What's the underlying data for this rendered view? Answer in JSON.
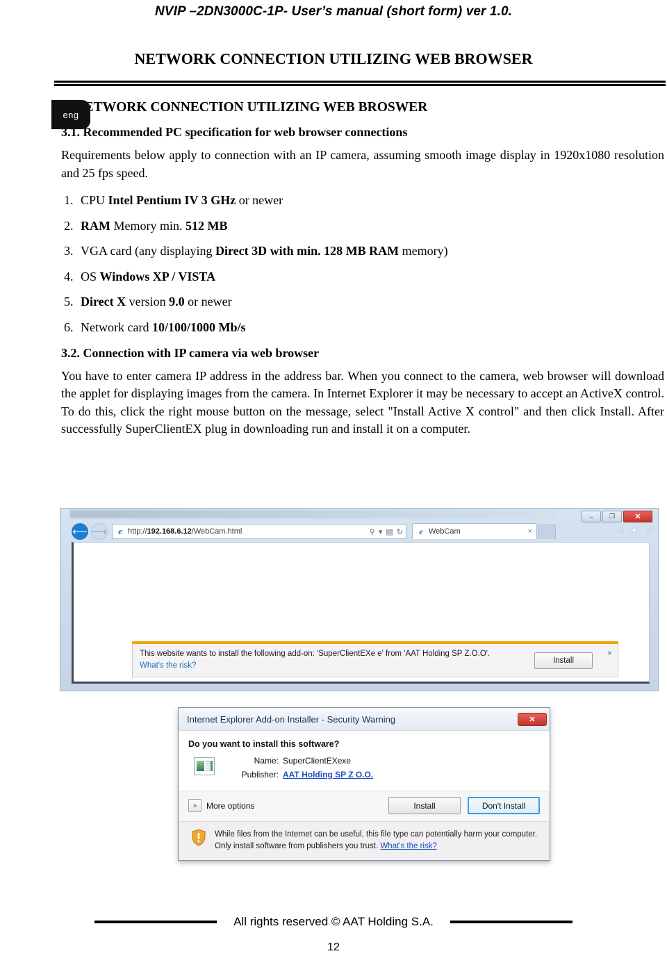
{
  "header": {
    "running_title": "NVIP –2DN3000C-1P- User’s manual (short form) ver 1.0."
  },
  "doc_title": "NETWORK CONNECTION UTILIZING WEB BROWSER",
  "language_tab": "eng",
  "sections": {
    "s3_heading": "3. NETWORK CONNECTION UTILIZING WEB BROSWER",
    "s31_heading": "3.1. Recommended PC specification for web browser connections",
    "s31_paragraph": "Requirements below apply to connection with an IP camera, assuming smooth image display in 1920x1080 resolution and 25 fps speed.",
    "s32_heading": "3.2. Connection with IP camera via web browser",
    "s32_paragraph": "You have to enter camera IP address in the address bar. When you connect to the camera, web browser will download the applet for displaying images from the camera. In Internet Explorer it may be necessary to accept an ActiveX control. To do this, click the right mouse button on the message, select \"Install Active X control\" and then click Install. After successfully SuperClientEX plug in downloading run and install it on a computer."
  },
  "specs": [
    {
      "prefix": "CPU ",
      "bold": "Intel Pentium IV 3 GHz",
      "suffix": " or newer"
    },
    {
      "prefix": "",
      "bold": "RAM",
      "mid": " Memory min. ",
      "bold2": "512 MB",
      "suffix": ""
    },
    {
      "prefix": "VGA card (any displaying ",
      "bold": "Direct 3D with min. 128 MB RAM",
      "suffix": " memory)"
    },
    {
      "prefix": "OS ",
      "bold": "Windows XP / VISTA",
      "suffix": ""
    },
    {
      "prefix": "",
      "bold": "Direct X",
      "mid": " version ",
      "bold2": "9.0",
      "suffix": " or newer"
    },
    {
      "prefix": "Network card ",
      "bold": "10/100/1000 Mb/s",
      "suffix": ""
    }
  ],
  "browser": {
    "back_icon": "arrow-left-icon",
    "forward_icon": "arrow-right-icon",
    "favicon": "e",
    "url_prefix": "http://",
    "url_host": "192.168.6.12",
    "url_path": "/WebCam.html",
    "search_icon": "⚲",
    "dropdown_icon": "▾",
    "page_icon": "▤",
    "refresh_icon": "↻",
    "tab_label": "WebCam",
    "tab_close": "×",
    "home_icon": "⌂",
    "favorites_icon": "★",
    "tools_icon": "⚙",
    "minimize_label": "–",
    "maximize_label": "❐",
    "close_label": "✕"
  },
  "notification": {
    "message": "This website wants to install the following add-on: 'SuperClientEXe e' from 'AAT Holding SP Z.O.O'.",
    "risk_link": "What's the risk?",
    "install_button": "Install",
    "close_icon": "×"
  },
  "dialog": {
    "title": "Internet Explorer Add-on Installer - Security Warning",
    "close_label": "✕",
    "question": "Do you want to install this software?",
    "name_label": "Name:",
    "name_value": "SuperClientEXexe",
    "publisher_label": "Publisher:",
    "publisher_value": "AAT Holding SP Z O.O.",
    "more_options": "More options",
    "more_options_icon": "»",
    "install_button": "Install",
    "dont_install_button": "Don't Install",
    "warning_text": "While files from the Internet can be useful, this file type can potentially harm your computer. Only install software from publishers you trust.",
    "warning_link": "What's the risk?"
  },
  "footer": {
    "copyright": "All rights reserved © AAT Holding S.A.",
    "page_number": "12"
  }
}
